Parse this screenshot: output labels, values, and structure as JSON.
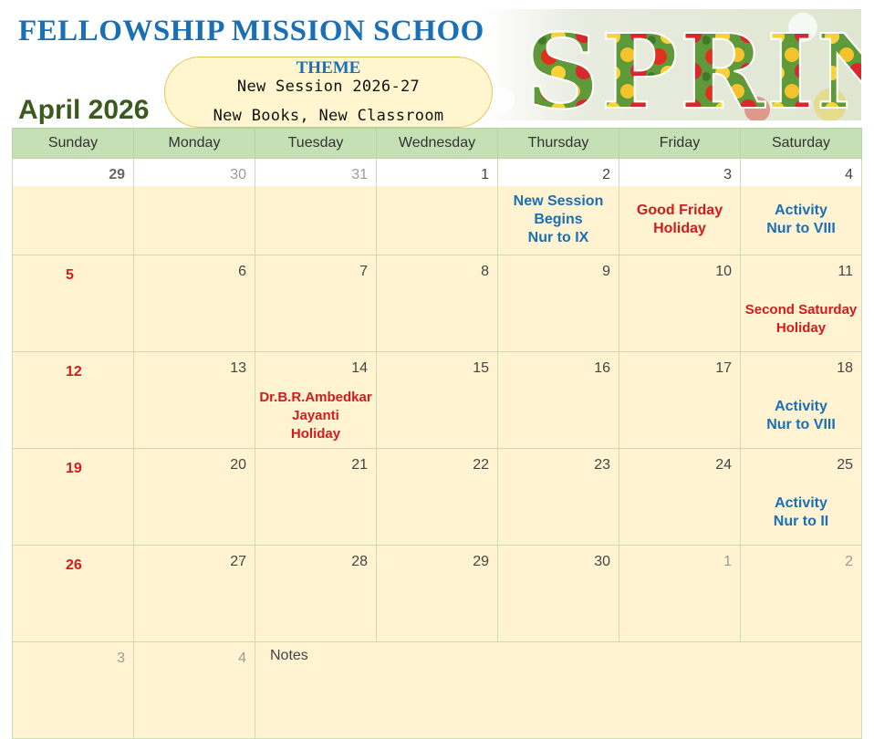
{
  "school_name": "FELLOWSHIP MISSION SCHOOL",
  "month_title": "April 2026",
  "theme": {
    "label": "THEME",
    "line1": "New Session 2026-27",
    "line2": "New Books, New Classroom"
  },
  "banner": {
    "word": "SPRING"
  },
  "weekdays": [
    "Sunday",
    "Monday",
    "Tuesday",
    "Wednesday",
    "Thursday",
    "Friday",
    "Saturday"
  ],
  "weeks": [
    {
      "days": [
        {
          "num": "29"
        },
        {
          "num": "30"
        },
        {
          "num": "31"
        },
        {
          "num": "1"
        },
        {
          "num": "2",
          "event": [
            "New Session",
            "Begins",
            "Nur to IX"
          ]
        },
        {
          "num": "3",
          "event": [
            "Good Friday",
            "Holiday"
          ]
        },
        {
          "num": "4",
          "event": [
            "Activity",
            "Nur to VIII"
          ]
        }
      ]
    },
    {
      "days": [
        {
          "num": "5"
        },
        {
          "num": "6"
        },
        {
          "num": "7"
        },
        {
          "num": "8"
        },
        {
          "num": "9"
        },
        {
          "num": "10"
        },
        {
          "num": "11",
          "event": [
            "Second Saturday",
            "Holiday"
          ]
        }
      ]
    },
    {
      "days": [
        {
          "num": "12"
        },
        {
          "num": "13"
        },
        {
          "num": "14",
          "event": [
            "Dr.B.R.Ambedkar",
            "Jayanti",
            "Holiday"
          ]
        },
        {
          "num": "15"
        },
        {
          "num": "16"
        },
        {
          "num": "17"
        },
        {
          "num": "18",
          "event": [
            "Activity",
            "Nur to VIII"
          ]
        }
      ]
    },
    {
      "days": [
        {
          "num": "19"
        },
        {
          "num": "20"
        },
        {
          "num": "21"
        },
        {
          "num": "22"
        },
        {
          "num": "23"
        },
        {
          "num": "24"
        },
        {
          "num": "25",
          "event": [
            "Activity",
            "Nur to II"
          ]
        }
      ]
    },
    {
      "days": [
        {
          "num": "26"
        },
        {
          "num": "27"
        },
        {
          "num": "28"
        },
        {
          "num": "29"
        },
        {
          "num": "30"
        },
        {
          "num": "1"
        },
        {
          "num": "2"
        }
      ]
    }
  ],
  "last_row": {
    "day1": "3",
    "day2": "4",
    "notes_label": "Notes"
  },
  "colors": {
    "blue": "#1a6fb5",
    "red": "#d01c1c",
    "header_green": "#c5e0b4",
    "cell_cream": "#fff3d2",
    "month_green": "#3a5a1e"
  }
}
